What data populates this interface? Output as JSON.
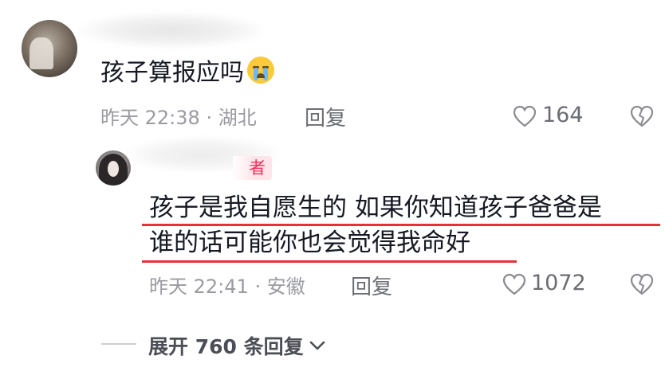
{
  "comment": {
    "text": "孩子算报应吗",
    "emoji_icon": "loudly-crying-face-icon",
    "time": "昨天 22:38",
    "location": "· 湖北",
    "reply_label": "回复",
    "likes": "164"
  },
  "reply": {
    "badge": "者",
    "line1": "孩子是我自愿生的 如果你知道孩子爸爸是",
    "line2": "谁的话可能你也会觉得我命好",
    "time": "昨天 22:41",
    "location": "· 安徽",
    "reply_label": "回复",
    "likes": "1072",
    "underline_color": "#e8303d"
  },
  "expand": {
    "label": "展开 760 条回复"
  },
  "colors": {
    "meta_gray": "#9a9ba1",
    "badge_bg": "#ffe4ea",
    "badge_text": "#fe2c55"
  }
}
